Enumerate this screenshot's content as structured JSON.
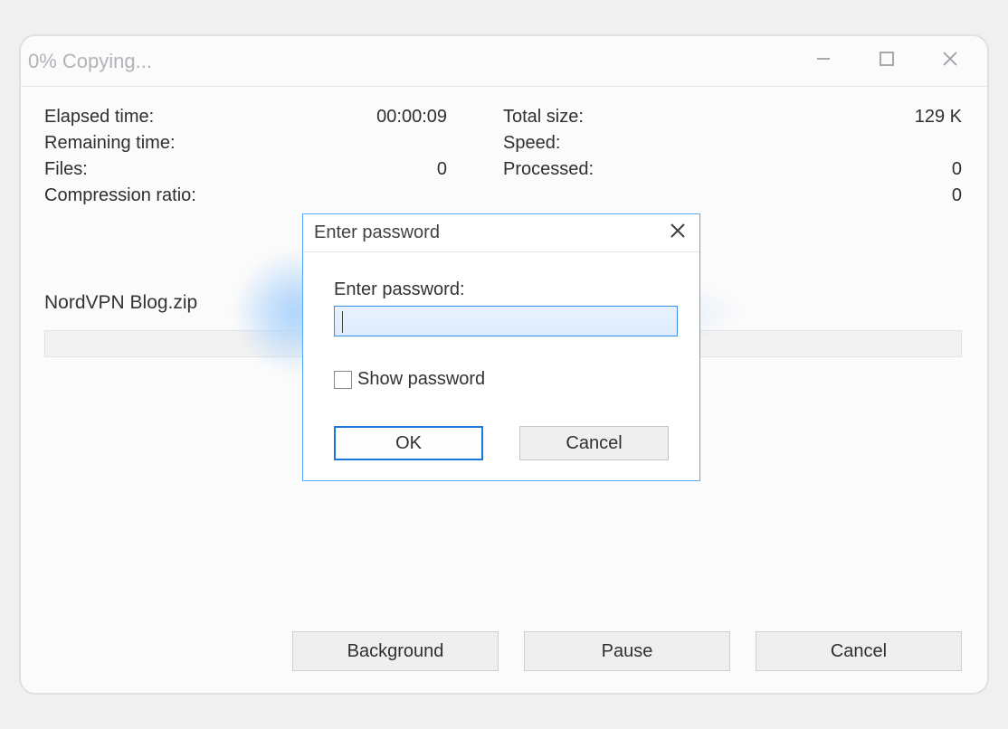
{
  "window": {
    "title": "0% Copying..."
  },
  "stats": {
    "elapsed_label": "Elapsed time:",
    "elapsed_value": "00:00:09",
    "remaining_label": "Remaining time:",
    "remaining_value": "",
    "files_label": "Files:",
    "files_value": "0",
    "ratio_label": "Compression ratio:",
    "ratio_value": "",
    "total_label": "Total size:",
    "total_value": "129 K",
    "speed_label": "Speed:",
    "speed_value": "",
    "processed_label": "Processed:",
    "processed_value": "0",
    "compressed_label": "",
    "compressed_value": "0"
  },
  "filename": "NordVPN Blog.zip",
  "main_buttons": {
    "background": "Background",
    "pause": "Pause",
    "cancel": "Cancel"
  },
  "dialog": {
    "title": "Enter password",
    "label": "Enter password:",
    "value": "",
    "show_label": "Show password",
    "ok": "OK",
    "cancel": "Cancel"
  }
}
